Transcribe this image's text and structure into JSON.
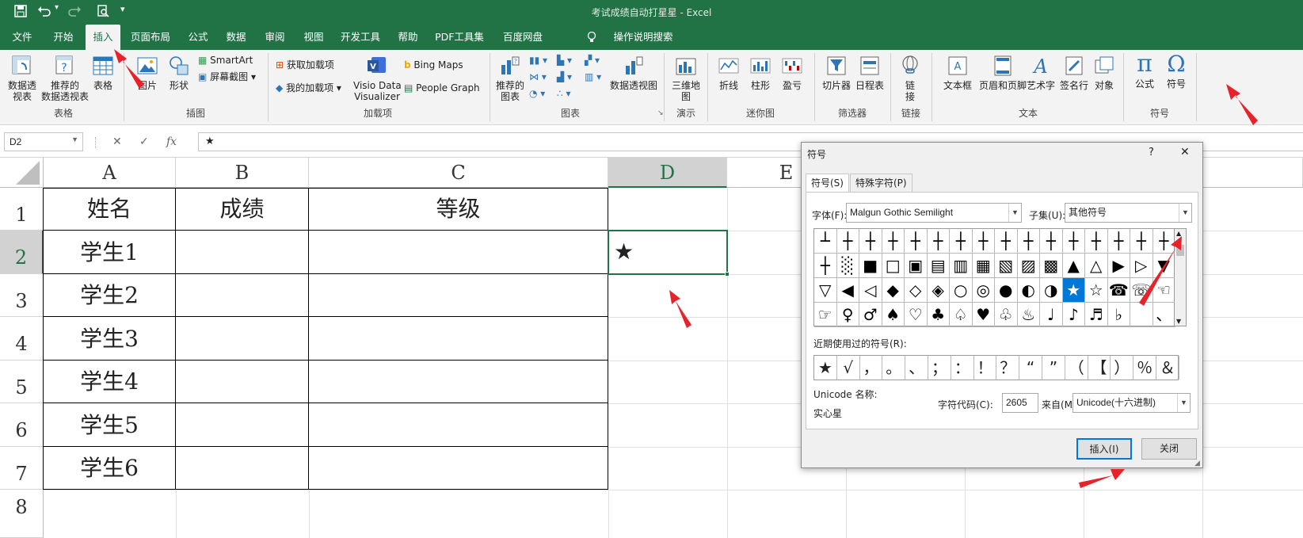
{
  "window": {
    "title": "考试成绩自动打星星  -  Excel"
  },
  "quick_access": {
    "save_icon": "save-icon",
    "undo_icon": "undo-icon",
    "redo_icon": "redo-icon",
    "print_preview_icon": "print-preview-icon",
    "customize_icon": "customize-icon"
  },
  "menu": {
    "tabs": [
      "文件",
      "开始",
      "插入",
      "页面布局",
      "公式",
      "数据",
      "审阅",
      "视图",
      "开发工具",
      "帮助",
      "PDF工具集",
      "百度网盘",
      "操作说明搜索"
    ],
    "active": "插入"
  },
  "ribbon": {
    "table_group": {
      "pivot": "数据透\n视表",
      "recommended_pivot": "推荐的\n数据透视表",
      "table": "表格",
      "name": "表格"
    },
    "illustrations_group": {
      "pictures": "图片",
      "shapes": "形状",
      "smartart": "SmartArt",
      "screenshot": "屏幕截图",
      "name": "插图"
    },
    "addins_group": {
      "get_addins": "获取加载项",
      "my_addins": "我的加载项",
      "visio": "Visio Data\nVisualizer",
      "bing_maps": "Bing Maps",
      "people_graph": "People Graph",
      "name": "加载项"
    },
    "charts_group": {
      "recommended_charts": "推荐的\n图表",
      "pivot_chart": "数据透视图",
      "name": "图表"
    },
    "tours_group": {
      "map3d": "三维地\n图",
      "name": "演示"
    },
    "sparklines_group": {
      "line": "折线",
      "column": "柱形",
      "winloss": "盈亏",
      "name": "迷你图"
    },
    "filters_group": {
      "slicer": "切片器",
      "timeline": "日程表",
      "name": "筛选器"
    },
    "links_group": {
      "link": "链\n接",
      "name": "链接"
    },
    "text_group": {
      "textbox": "文本框",
      "header_footer": "页眉和页脚",
      "wordart": "艺术字",
      "signature": "签名行",
      "object": "对象",
      "name": "文本"
    },
    "symbols_group": {
      "equation": "公式",
      "symbol": "符号",
      "name": "符号"
    }
  },
  "formula_bar": {
    "name_box": "D2",
    "content": "★",
    "cancel": "✕",
    "enter": "✓",
    "fx": "fx"
  },
  "sheet": {
    "columns": [
      "A",
      "B",
      "C",
      "D",
      "E"
    ],
    "rows": [
      "1",
      "2",
      "3",
      "4",
      "5",
      "6",
      "7",
      "8"
    ],
    "headers": {
      "name": "姓名",
      "score": "成绩",
      "grade": "等级"
    },
    "students": [
      "学生1",
      "学生2",
      "学生3",
      "学生4",
      "学生5",
      "学生6"
    ],
    "d2_value": "★"
  },
  "dialog": {
    "title": "符号",
    "help": "?",
    "close": "✕",
    "tabs": [
      "符号(S)",
      "特殊字符(P)"
    ],
    "font_label": "字体(F):",
    "font_value": "Malgun Gothic Semilight",
    "subset_label": "子集(U):",
    "subset_value": "其他符号",
    "symbols": [
      [
        "┴",
        "┼",
        "┼",
        "┼",
        "┼",
        "┼",
        "┼",
        "┼",
        "┼",
        "┼",
        "┼",
        "┼",
        "┼",
        "┼",
        "┼",
        "┼"
      ],
      [
        "┼",
        "░",
        "■",
        "□",
        "▣",
        "▤",
        "▥",
        "▦",
        "▧",
        "▨",
        "▩",
        "▲",
        "△",
        "▶",
        "▷",
        "▼"
      ],
      [
        "▽",
        "◀",
        "◁",
        "◆",
        "◇",
        "◈",
        "○",
        "◎",
        "●",
        "◐",
        "◑",
        "★",
        "☆",
        "☎",
        "☏",
        "☜"
      ],
      [
        "☞",
        "♀",
        "♂",
        "♠",
        "♡",
        "♣",
        "♤",
        "♥",
        "♧",
        "♨",
        "♩",
        "♪",
        "♬",
        "♭",
        "",
        "、"
      ]
    ],
    "selected_symbol": "★",
    "recent_label": "近期使用过的符号(R):",
    "recent": [
      "★",
      "√",
      "，",
      "。",
      "、",
      "；",
      "：",
      "！",
      "？",
      "“",
      "”",
      "（",
      "【",
      "）",
      "％",
      "＆"
    ],
    "unicode_name_label": "Unicode 名称:",
    "unicode_name": "实心星",
    "char_code_label": "字符代码(C):",
    "char_code": "2605",
    "from_label": "来自(M):",
    "from_value": "Unicode(十六进制)",
    "insert_button": "插入(I)",
    "close_button": "关闭"
  },
  "colors": {
    "excel_green": "#217346",
    "selection_blue": "#0078d7",
    "arrow_red": "#e8222b"
  }
}
